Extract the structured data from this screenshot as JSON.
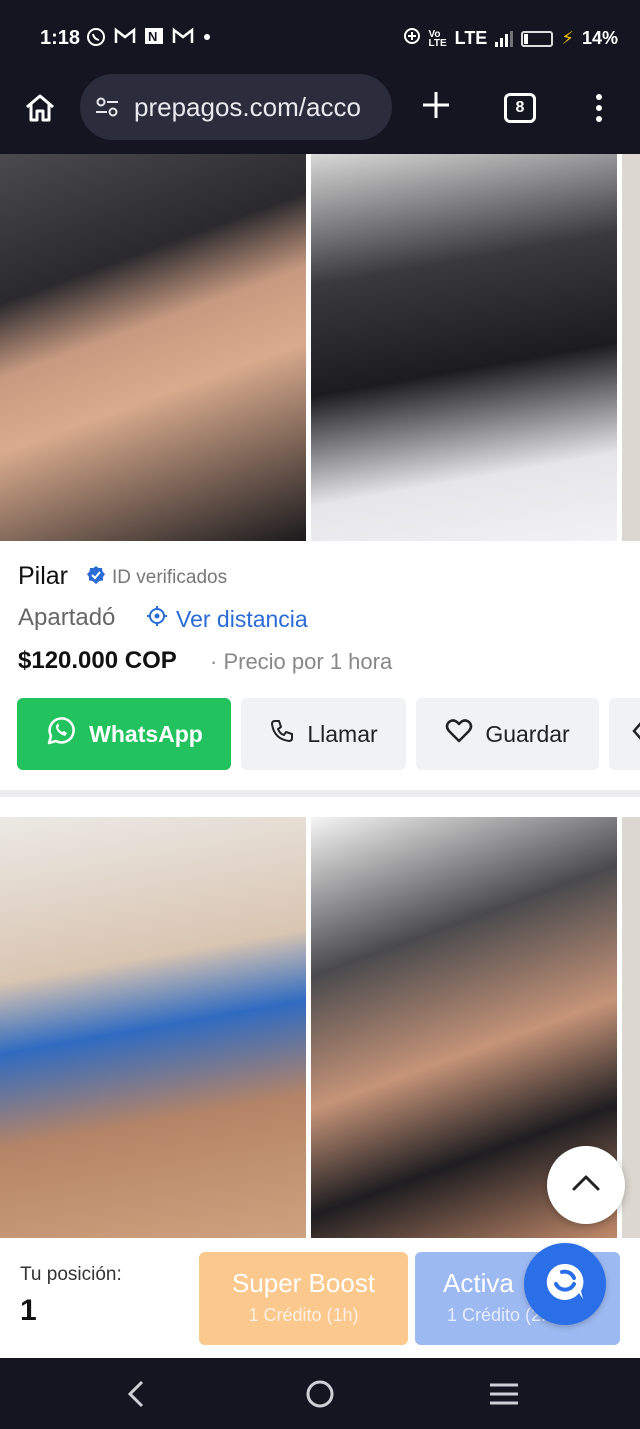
{
  "status_bar": {
    "time": "1:18",
    "notification_icons": [
      "whatsapp-icon",
      "gmail-icon",
      "news-icon",
      "gmail-icon"
    ],
    "network": "LTE",
    "battery": "14%"
  },
  "browser": {
    "url": "prepagos.com/acco",
    "tab_count": "8"
  },
  "listing": {
    "name": "Pilar",
    "verified_label": "ID verificados",
    "location": "Apartadó",
    "distance_link": "Ver distancia",
    "price": "$120.000 COP",
    "price_note": "· Precio por 1 hora",
    "buttons": {
      "whatsapp": "WhatsApp",
      "call": "Llamar",
      "save": "Guardar"
    }
  },
  "promo": {
    "position_label": "Tu posición:",
    "position_value": "1",
    "boost_title": "Super Boost",
    "boost_sub": "1 Crédito (1h)",
    "activa_title": "Activa",
    "activa_sub": "1 Crédito (2..."
  },
  "colors": {
    "whatsapp_green": "#22c35e",
    "link_blue": "#2a6bd6",
    "boost_orange": "#fbc88e",
    "activa_blue": "#9db9f1",
    "chat_blue": "#2a6fe8"
  }
}
